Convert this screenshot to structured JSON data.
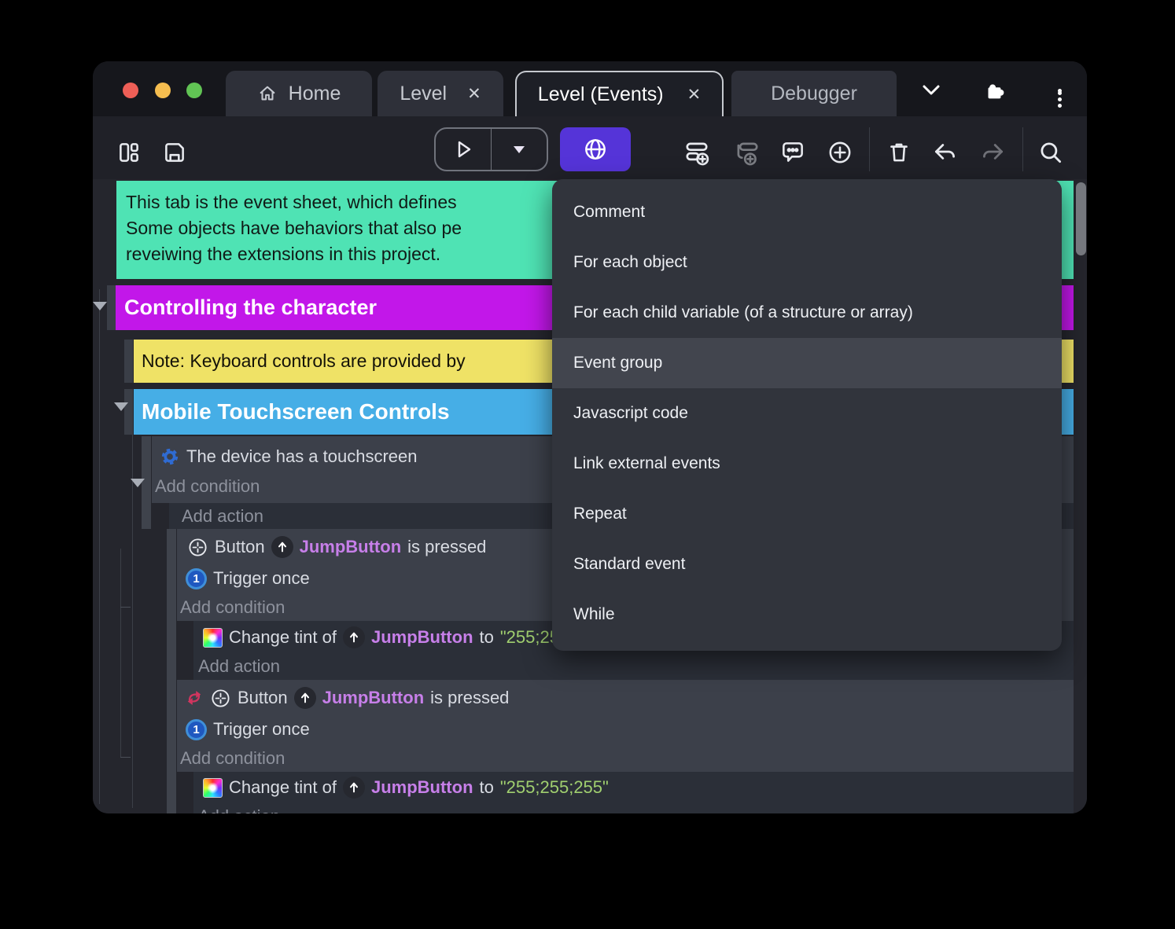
{
  "colors": {
    "accent_purple": "#5534d8",
    "comment_teal": "#4fe3b4",
    "group_magenta": "#c217e9",
    "note_yellow": "#efe266",
    "group_blue": "#46aee6",
    "object_purple": "#c77fe9",
    "string_green": "#a0cf6f",
    "traffic_red": "#ee5f57",
    "traffic_yellow": "#f5bd4f",
    "traffic_green": "#61c454"
  },
  "titlebar": {
    "close_glyph": "✕",
    "tabs": [
      {
        "label": "Home"
      },
      {
        "label": "Level"
      },
      {
        "label": "Level (Events)"
      },
      {
        "label": "Debugger"
      }
    ]
  },
  "menu": {
    "highlighted": "Event group",
    "items": [
      "Comment",
      "For each object",
      "For each child variable (of a structure or array)",
      "Event group",
      "Javascript code",
      "Link external events",
      "Repeat",
      "Standard event",
      "While"
    ]
  },
  "sheet": {
    "comment": {
      "line1": "This tab is the event sheet, which defines",
      "line2": "Some objects have behaviors that also pe",
      "line3": "reveiwing the extensions in this project."
    },
    "group_controlling": "Controlling the character",
    "note_keyboard": "Note: Keyboard controls are provided by",
    "group_mobile": "Mobile Touchscreen Controls",
    "touch_condition": "The device has a touchscreen",
    "add_condition": "Add condition",
    "add_action": "Add action",
    "button_label": "Button",
    "object_name": "JumpButton",
    "is_pressed": "is pressed",
    "trigger_once": "Trigger once",
    "trigger_glyph": "1",
    "change_tint_of": "Change tint of",
    "to_word": "to",
    "tint_value": "\"255;255;255\""
  }
}
